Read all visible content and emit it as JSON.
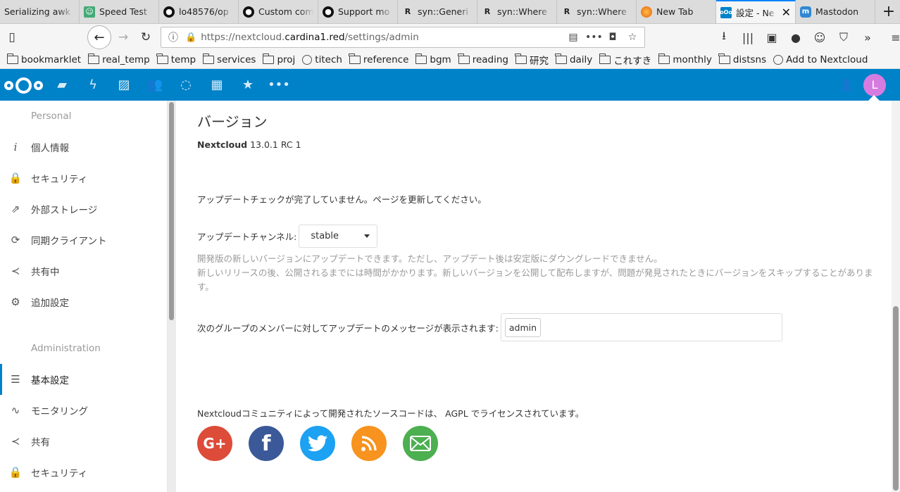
{
  "browser": {
    "tabs": [
      {
        "title": "Serializing awk",
        "favicon": "",
        "active": false
      },
      {
        "title": "Speed Test",
        "favicon": "speedtest-icon",
        "active": false
      },
      {
        "title": "lo48576/op",
        "favicon": "github-icon",
        "active": false
      },
      {
        "title": "Custom com",
        "favicon": "github-icon",
        "active": false
      },
      {
        "title": "Support mo",
        "favicon": "github-icon",
        "active": false
      },
      {
        "title": "syn::Generi",
        "favicon": "rust-icon",
        "active": false
      },
      {
        "title": "syn::Where",
        "favicon": "rust-icon",
        "active": false
      },
      {
        "title": "syn::Where",
        "favicon": "rust-icon",
        "active": false
      },
      {
        "title": "New Tab",
        "favicon": "firefox-icon",
        "active": false
      },
      {
        "title": "設定 - Ne",
        "favicon": "nextcloud-icon",
        "active": true
      },
      {
        "title": "Mastodon",
        "favicon": "mastodon-icon",
        "active": false
      }
    ],
    "new_tab_label": "+",
    "url_prefix": "https://nextcloud.",
    "url_domain": "cardina1.red",
    "url_path": "/settings/admin",
    "bookmarks": [
      {
        "label": "bookmarklet",
        "type": "folder"
      },
      {
        "label": "real_temp",
        "type": "folder"
      },
      {
        "label": "temp",
        "type": "folder"
      },
      {
        "label": "services",
        "type": "folder"
      },
      {
        "label": "proj",
        "type": "folder"
      },
      {
        "label": "titech",
        "type": "site"
      },
      {
        "label": "reference",
        "type": "folder"
      },
      {
        "label": "bgm",
        "type": "folder"
      },
      {
        "label": "reading",
        "type": "folder"
      },
      {
        "label": "研究",
        "type": "folder"
      },
      {
        "label": "daily",
        "type": "folder"
      },
      {
        "label": "これすき",
        "type": "folder"
      },
      {
        "label": "monthly",
        "type": "folder"
      },
      {
        "label": "distsns",
        "type": "folder"
      },
      {
        "label": "Add to Nextcloud",
        "type": "site"
      }
    ]
  },
  "nextcloud": {
    "brand_color": "#0082c9",
    "avatar_letter": "L",
    "avatar_color": "#d67ce0"
  },
  "sidebar": {
    "personal_heading": "Personal",
    "personal_items": [
      {
        "label": "個人情報",
        "icon": "info-icon"
      },
      {
        "label": "セキュリティ",
        "icon": "lock-icon"
      },
      {
        "label": "外部ストレージ",
        "icon": "external-icon"
      },
      {
        "label": "同期クライアント",
        "icon": "sync-icon"
      },
      {
        "label": "共有中",
        "icon": "share-icon"
      },
      {
        "label": "追加設定",
        "icon": "gear-icon"
      }
    ],
    "admin_heading": "Administration",
    "admin_items": [
      {
        "label": "基本設定",
        "icon": "list-icon",
        "active": true
      },
      {
        "label": "モニタリング",
        "icon": "activity-icon"
      },
      {
        "label": "共有",
        "icon": "share-icon"
      },
      {
        "label": "セキュリティ",
        "icon": "lock-icon"
      }
    ]
  },
  "main": {
    "title": "バージョン",
    "product": "Nextcloud",
    "version": "13.0.1 RC 1",
    "update_notice": "アップデートチェックが完了していません。ページを更新してください。",
    "channel_label": "アップデートチャンネル:",
    "channel_value": "stable",
    "hint_line1": "開発版の新しいバージョンにアップデートできます。ただし、アップデート後は安定版にダウングレードできません。",
    "hint_line2": "新しいリリースの後、公開されるまでには時間がかかります。新しいバージョンを公開して配布しますが、問題が発見されたときにバージョンをスキップすることがあります。",
    "group_label": "次のグループのメンバーに対してアップデートのメッセージが表示されます:",
    "group_chip": "admin",
    "license_text_1": "Nextcloudコミュニティ",
    "license_text_2": "によって開発された",
    "license_text_3": "ソースコード",
    "license_text_4": "は、",
    "license_text_5": "AGPL",
    "license_text_6": "でライセンスされています。",
    "socials": [
      {
        "name": "google-plus",
        "glyph": "G+",
        "color": "#dd4b39"
      },
      {
        "name": "facebook",
        "glyph": "f",
        "color": "#3b5998"
      },
      {
        "name": "twitter",
        "glyph": "🐦",
        "color": "#1da1f2"
      },
      {
        "name": "rss",
        "glyph": "◉",
        "color": "#f7931e"
      },
      {
        "name": "email",
        "glyph": "✉",
        "color": "#4caf50"
      }
    ]
  }
}
